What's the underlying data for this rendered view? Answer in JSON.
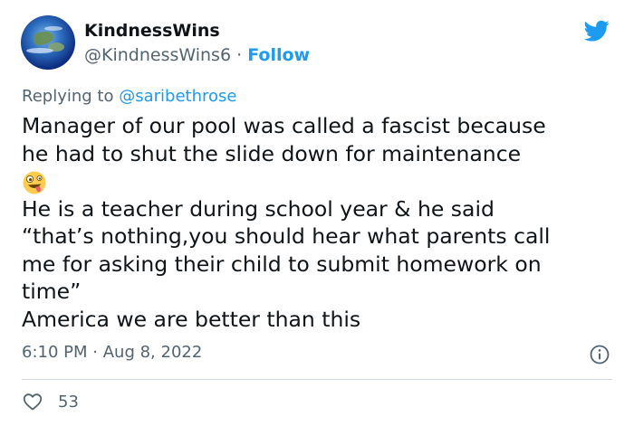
{
  "author": {
    "display_name": "KindnessWins",
    "handle": "@KindnessWins6",
    "separator": "·",
    "follow_label": "Follow"
  },
  "reply": {
    "prefix": "Replying to",
    "mention": "@saribethrose"
  },
  "tweet": {
    "line1": "Manager of our pool was called a fascist because",
    "line2": "he had to shut the slide down for maintenance",
    "emoji": "zany-face-emoji",
    "line3": "He is a teacher during school year & he said",
    "line4": "“that’s nothing,you should hear what parents call",
    "line5": "me for asking their child to submit homework on",
    "line6": "time”",
    "line7": "America we are better than this"
  },
  "meta": {
    "time": "6:10 PM",
    "separator": "·",
    "date": "Aug 8, 2022"
  },
  "engagement": {
    "likes": "53"
  },
  "colors": {
    "accent": "#1d9bf0",
    "text": "#0f1419",
    "secondary": "#536471",
    "divider": "#cfd9de"
  },
  "icons": [
    "twitter-bird-icon",
    "info-icon",
    "heart-icon"
  ]
}
